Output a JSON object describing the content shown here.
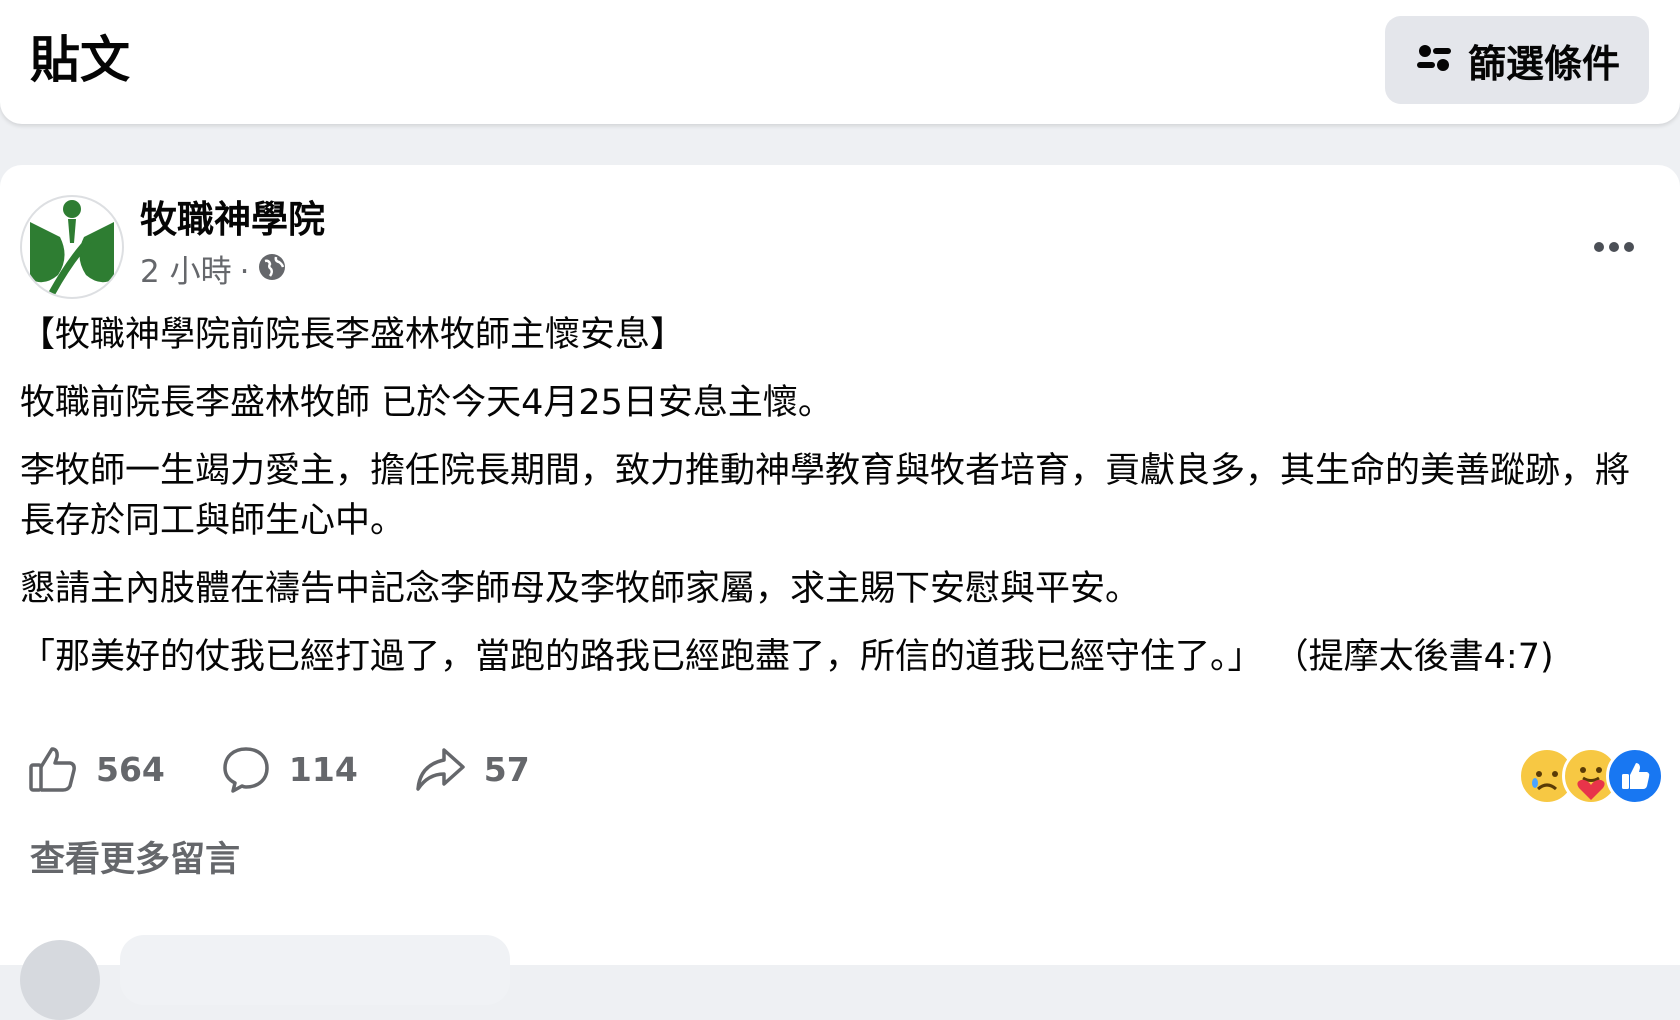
{
  "header": {
    "title": "貼文",
    "filter_label": "篩選條件"
  },
  "post": {
    "page_name": "牧職神學院",
    "time": "2 小時",
    "separator": "·",
    "paragraphs": [
      "【牧職神學院前院長李盛林牧師主懷安息】",
      "牧職前院長李盛林牧師 已於今天4月25日安息主懷。",
      "李牧師一生竭力愛主，擔任院長期間，致力推動神學教育與牧者培育，貢獻良多，其生命的美善蹤跡，將長存於同工與師生心中。",
      "懇請主內肢體在禱告中記念李師母及李牧師家屬，求主賜下安慰與平安。",
      "「那美好的仗我已經打過了，當跑的路我已經跑盡了，所信的道我已經守住了。」 （提摩太後書4:7)"
    ],
    "likes": "564",
    "comments": "114",
    "shares": "57",
    "reactions": [
      "sad-reaction",
      "care-reaction",
      "like-reaction"
    ],
    "more_comments": "查看更多留言"
  },
  "colors": {
    "page_bg": "#eef0f3",
    "card_bg": "#ffffff",
    "secondary_text": "#65676b",
    "button_bg": "#e4e6eb",
    "like_blue": "#1877f2",
    "logo_green": "#2e7d32"
  }
}
